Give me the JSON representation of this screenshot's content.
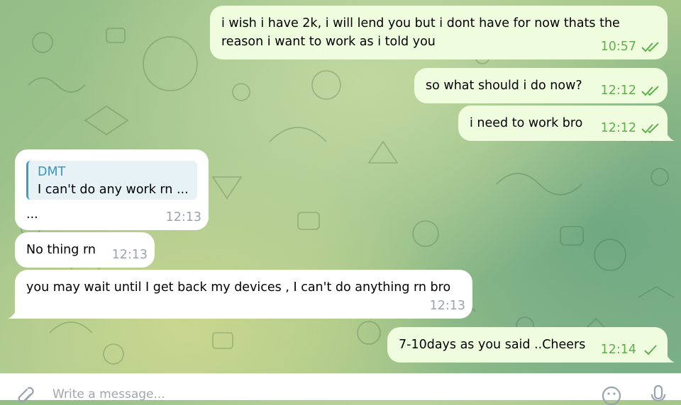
{
  "colors": {
    "outgoing_bubble": "#effdde",
    "incoming_bubble": "#ffffff",
    "outgoing_time": "#5fb04d",
    "incoming_time": "#9aa4ad",
    "reply_accent": "#3a9ec8"
  },
  "messages": [
    {
      "direction": "out",
      "text": "i wish i have 2k, i will lend you but i dont have for now thats the reason i want to work as i told you",
      "line1": "i wish i have 2k, i will lend you but i dont have for now thats the",
      "line2": "reason i want to work as i told you",
      "time": "10:57",
      "status": "read-double-check-icon"
    },
    {
      "direction": "out",
      "text": "so what should i do now?",
      "time": "12:12",
      "status": "read-double-check-icon"
    },
    {
      "direction": "out",
      "text": "i need to work bro",
      "time": "12:12",
      "status": "read-double-check-icon"
    },
    {
      "direction": "in",
      "reply_to": {
        "name": "DMT",
        "text": "I can't do any work rn ..."
      },
      "text": "...",
      "time": "12:13"
    },
    {
      "direction": "in",
      "text": "No thing rn",
      "time": "12:13"
    },
    {
      "direction": "in",
      "text": "you may wait until I get back my devices , I can't do anything rn bro",
      "time": "12:13"
    },
    {
      "direction": "out",
      "text": "7-10days as you said ..Cheers",
      "time": "12:14",
      "status": "sent-single-check-icon"
    }
  ],
  "composer": {
    "placeholder": "Write a message...",
    "attach_icon": "paperclip-icon",
    "emoji_icon": "smiley-icon",
    "voice_icon": "microphone-icon"
  }
}
